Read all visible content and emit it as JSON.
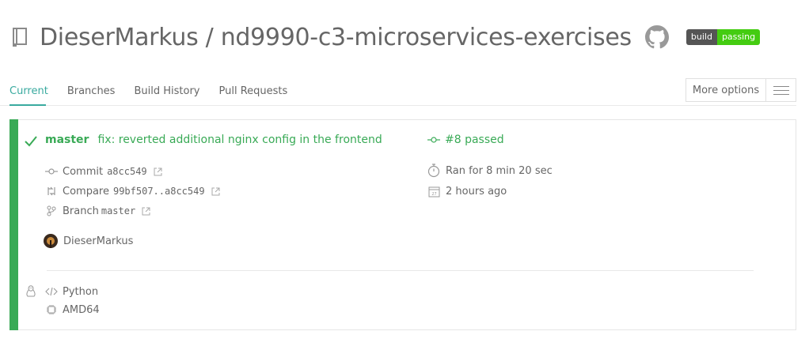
{
  "repo": {
    "owner": "DieserMarkus",
    "separator": "/",
    "name": "nd9990-c3-microservices-exercises",
    "title": "DieserMarkus / nd9990-c3-microservices-exercises",
    "badge_label": "build",
    "badge_status": "passing"
  },
  "tabs": [
    {
      "label": "Current",
      "active": true
    },
    {
      "label": "Branches",
      "active": false
    },
    {
      "label": "Build History",
      "active": false
    },
    {
      "label": "Pull Requests",
      "active": false
    }
  ],
  "more_options_label": "More options",
  "build": {
    "status": "passed",
    "branch": "master",
    "commit_message": "fix: reverted additional nginx config in the frontend",
    "build_number_text": "#8 passed",
    "commit_label": "Commit",
    "commit_sha": "a8cc549",
    "compare_label": "Compare",
    "compare_range": "99bf507..a8cc549",
    "branch_label": "Branch",
    "branch_value": "master",
    "duration": "Ran for 8 min 20 sec",
    "finished": "2 hours ago",
    "author": "DieserMarkus",
    "language": "Python",
    "arch": "AMD64"
  },
  "colors": {
    "accent": "#39aa9f",
    "passed": "#39aa56",
    "badge_passing": "#44cc11",
    "badge_label_bg": "#555555"
  },
  "icons": [
    "repo-icon",
    "github-icon",
    "check-icon",
    "commit-icon",
    "compare-icon",
    "branch-icon",
    "external-link-icon",
    "stopwatch-icon",
    "calendar-icon",
    "linux-icon",
    "code-icon",
    "cpu-icon",
    "hamburger-icon"
  ]
}
